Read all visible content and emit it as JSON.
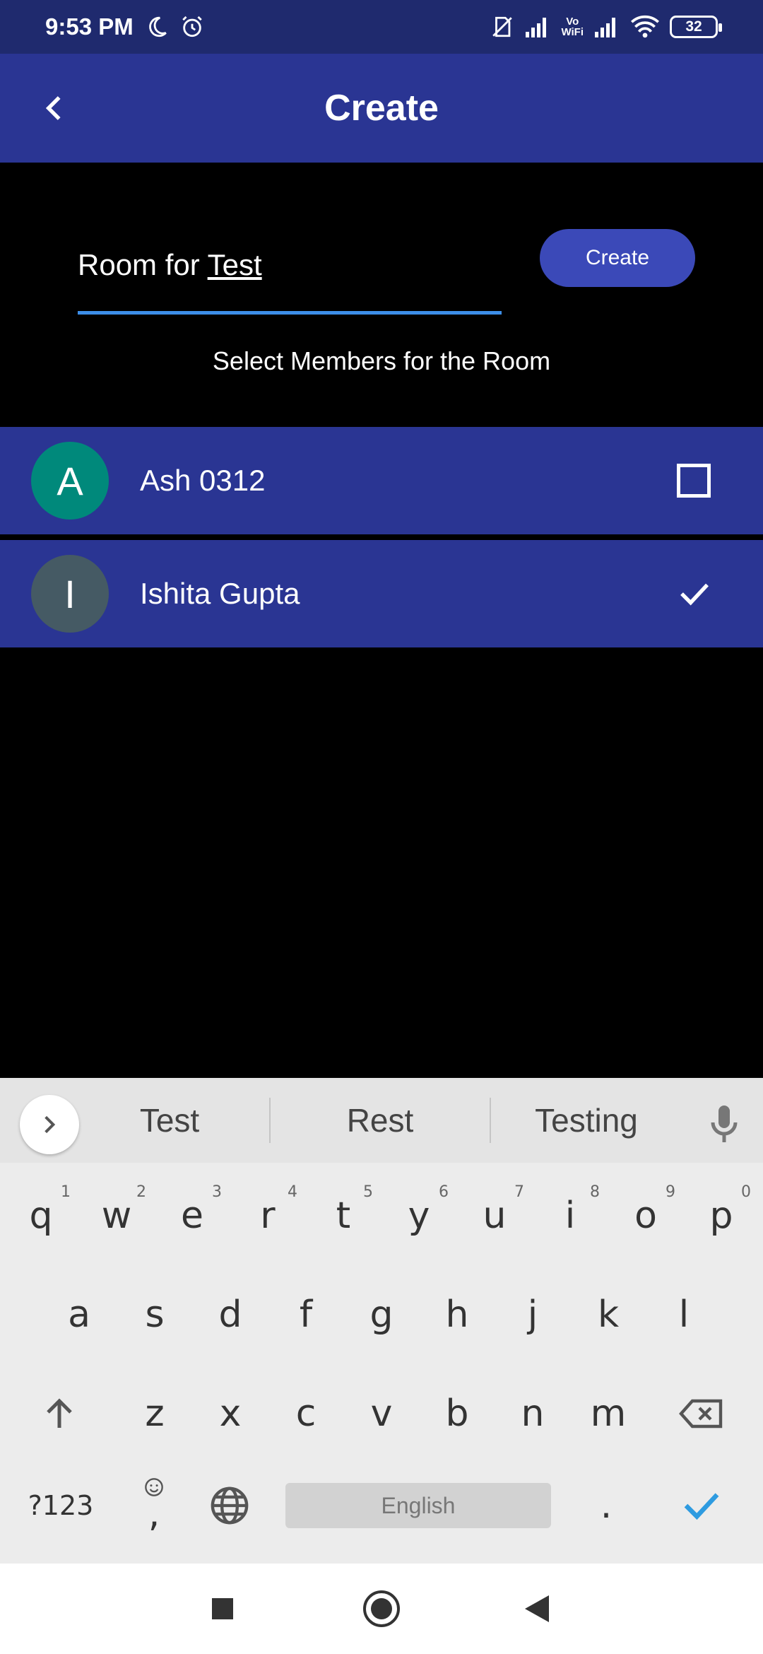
{
  "status_bar": {
    "time": "9:53 PM",
    "battery": "32",
    "vowifi_top": "Vo",
    "vowifi_bottom": "WiFi"
  },
  "app_bar": {
    "title": "Create",
    "back_icon": "chevron-left-icon"
  },
  "form": {
    "room_name_prefix": "Room for ",
    "room_name_composing": "Test",
    "create_label": "Create",
    "select_label": "Select Members for the Room"
  },
  "members": [
    {
      "initial": "A",
      "name": "Ash 0312",
      "avatar_color": "#00897b",
      "checked": false
    },
    {
      "initial": "I",
      "name": "Ishita Gupta",
      "avatar_color": "#455a64",
      "checked": true
    }
  ],
  "keyboard": {
    "suggestions": [
      "Test",
      "Rest",
      "Testing"
    ],
    "row1": [
      "q",
      "w",
      "e",
      "r",
      "t",
      "y",
      "u",
      "i",
      "o",
      "p"
    ],
    "row1_digits": [
      "1",
      "2",
      "3",
      "4",
      "5",
      "6",
      "7",
      "8",
      "9",
      "0"
    ],
    "row2": [
      "a",
      "s",
      "d",
      "f",
      "g",
      "h",
      "j",
      "k",
      "l"
    ],
    "row3": [
      "z",
      "x",
      "c",
      "v",
      "b",
      "n",
      "m"
    ],
    "symbols_label": "?123",
    "comma_label": ",",
    "space_label": "English",
    "period_label": ".",
    "accent_color": "#2e9be0"
  },
  "colors": {
    "app_bar": "#2a3593",
    "status_bar": "#1f2a6e",
    "create_button": "#3b49b8",
    "input_underline": "#3d8ee8"
  }
}
